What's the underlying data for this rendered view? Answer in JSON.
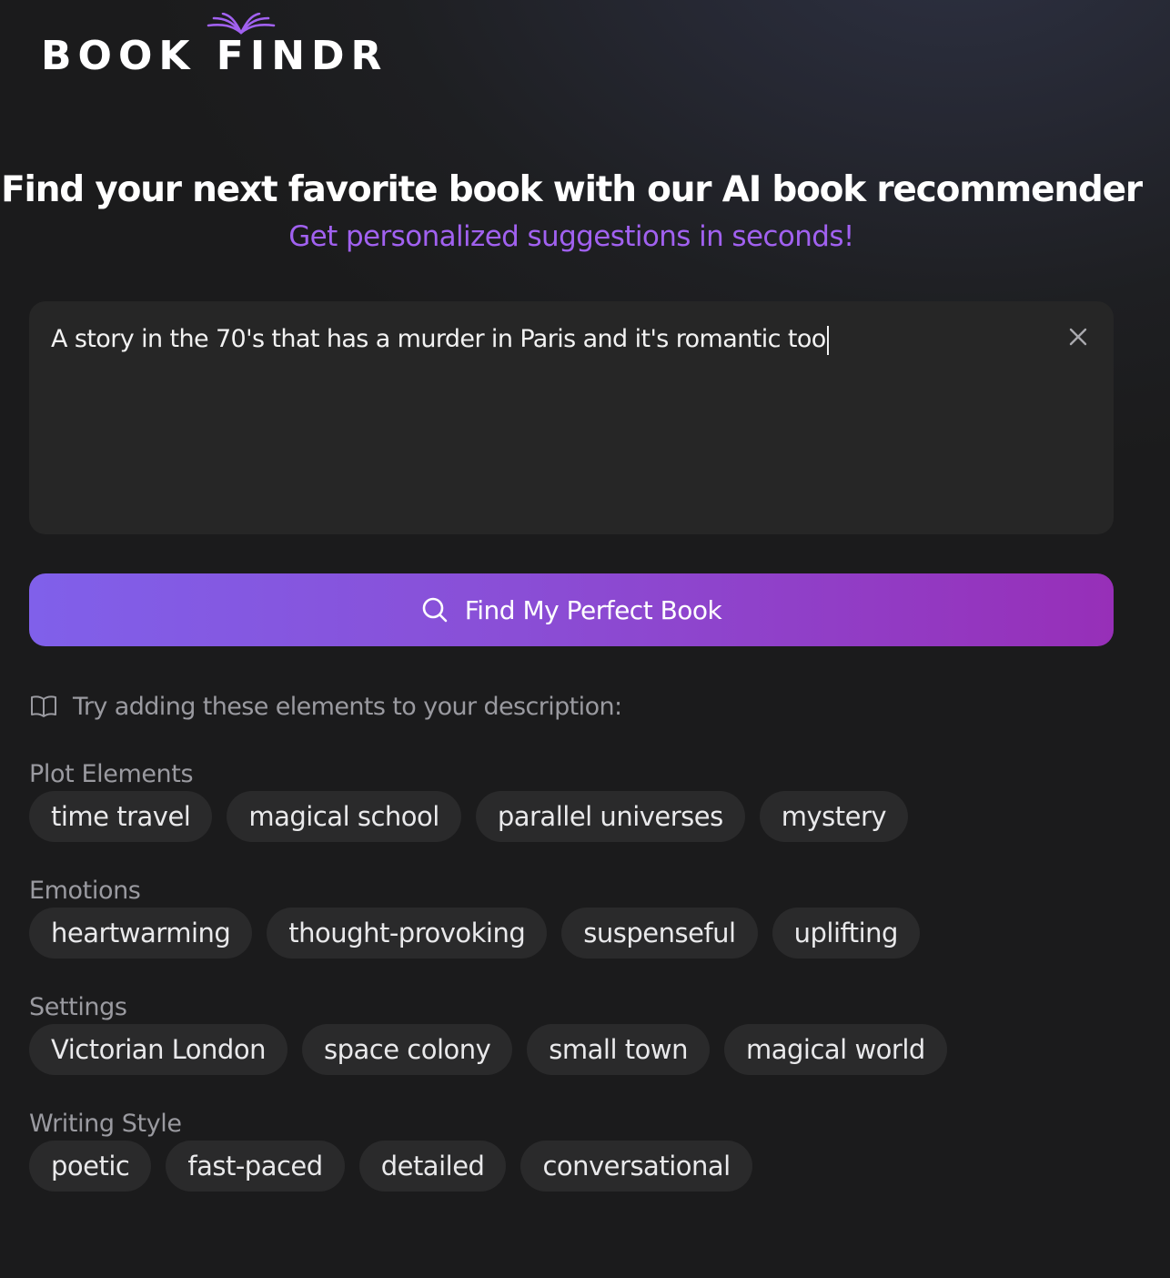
{
  "brand": {
    "logo_text": "BOOK FINDR",
    "logo_icon": "open-book-icon",
    "accent_color": "#a161f0"
  },
  "hero": {
    "headline": "Find your next favorite book with our AI book recommender",
    "subheadline": "Get personalized suggestions in seconds!"
  },
  "search": {
    "value": "A story in the 70's that has a murder in Paris and it's romantic too",
    "clear_icon": "close-icon"
  },
  "find_button": {
    "label": "Find My Perfect Book",
    "icon": "search-icon",
    "gradient_start": "#8060ea",
    "gradient_end": "#972fb8"
  },
  "hint": {
    "icon": "book-open-icon",
    "text": "Try adding these elements to your description:"
  },
  "groups": [
    {
      "title": "Plot Elements",
      "chips": [
        "time travel",
        "magical school",
        "parallel universes",
        "mystery"
      ]
    },
    {
      "title": "Emotions",
      "chips": [
        "heartwarming",
        "thought-provoking",
        "suspenseful",
        "uplifting"
      ]
    },
    {
      "title": "Settings",
      "chips": [
        "Victorian London",
        "space colony",
        "small town",
        "magical world"
      ]
    },
    {
      "title": "Writing Style",
      "chips": [
        "poetic",
        "fast-paced",
        "detailed",
        "conversational"
      ]
    }
  ]
}
